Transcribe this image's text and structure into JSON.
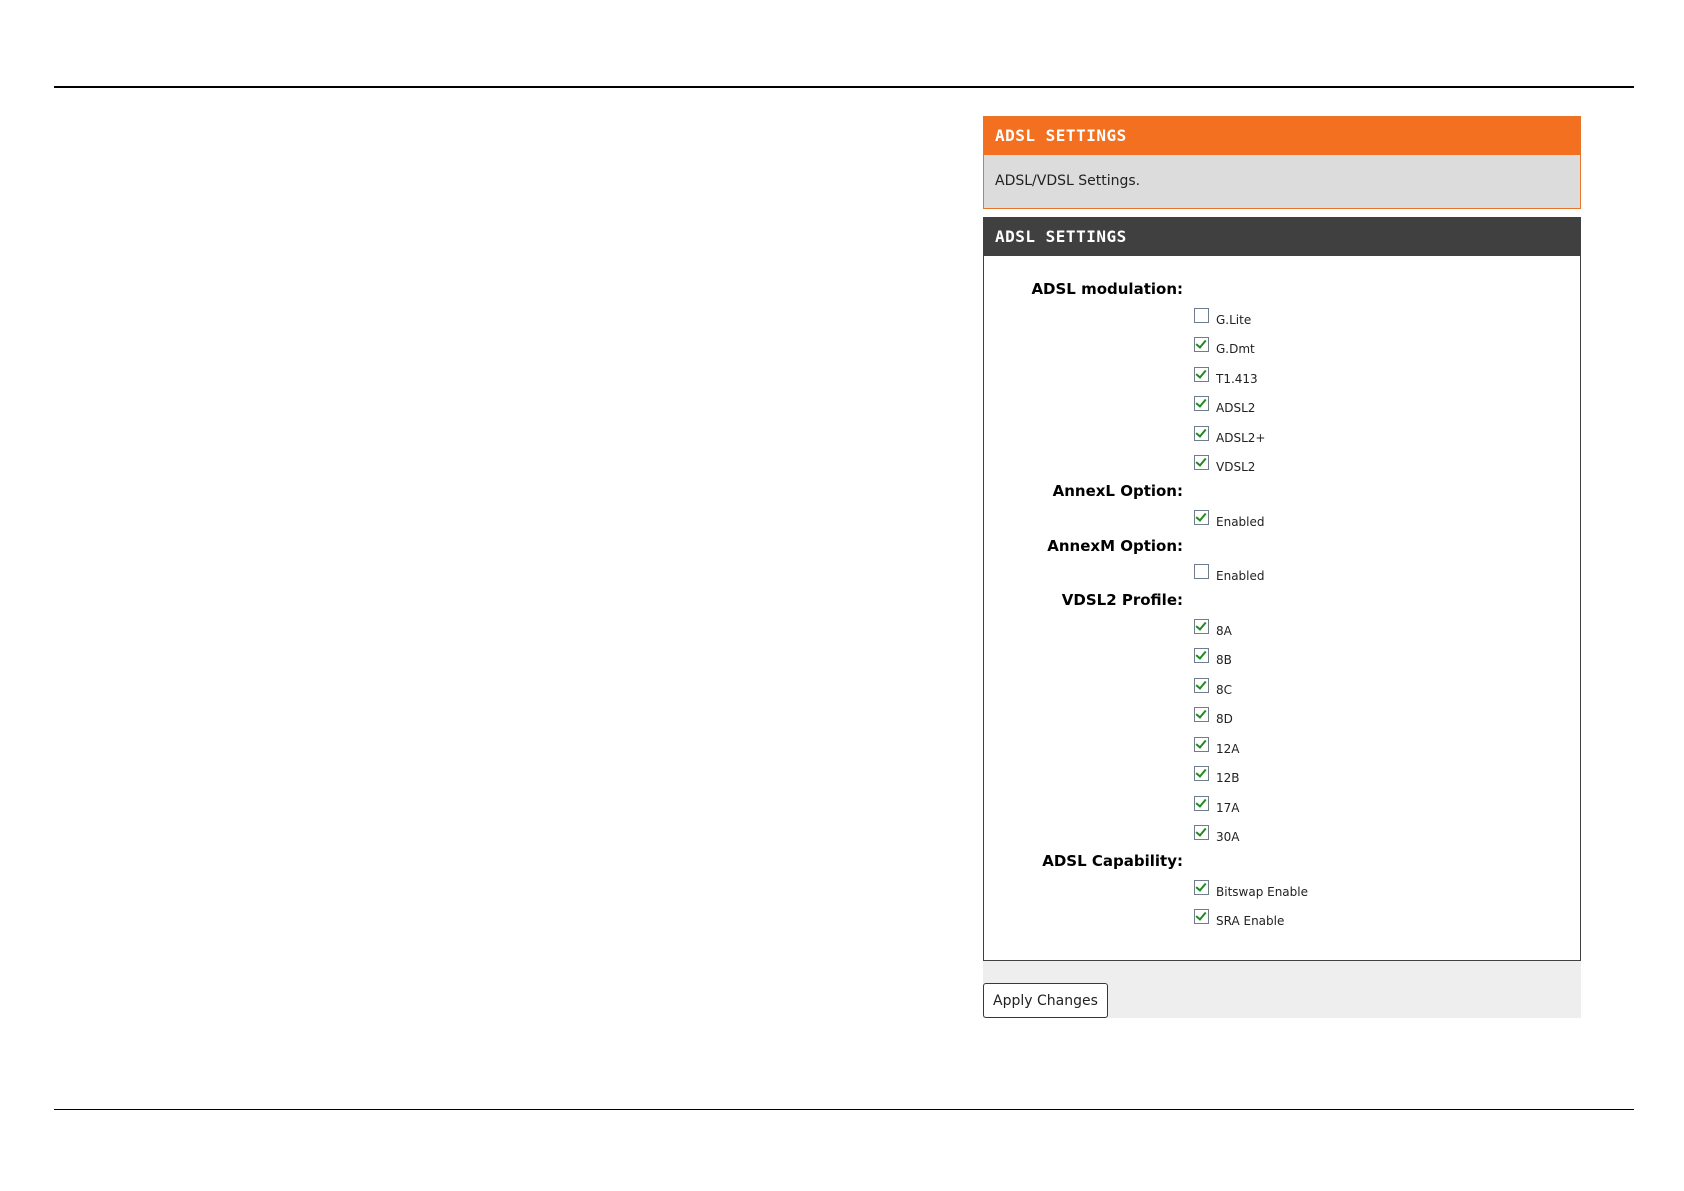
{
  "info": {
    "title": "ADSL SETTINGS",
    "description": "ADSL/VDSL Settings."
  },
  "settings": {
    "title": "ADSL SETTINGS",
    "groups": [
      {
        "label": "ADSL modulation:",
        "options": [
          {
            "label": "G.Lite",
            "checked": false
          },
          {
            "label": "G.Dmt",
            "checked": true
          },
          {
            "label": "T1.413",
            "checked": true
          },
          {
            "label": "ADSL2",
            "checked": true
          },
          {
            "label": "ADSL2+",
            "checked": true
          },
          {
            "label": "VDSL2",
            "checked": true
          }
        ]
      },
      {
        "label": "AnnexL Option:",
        "options": [
          {
            "label": "Enabled",
            "checked": true
          }
        ]
      },
      {
        "label": "AnnexM Option:",
        "options": [
          {
            "label": "Enabled",
            "checked": false
          }
        ]
      },
      {
        "label": "VDSL2 Profile:",
        "options": [
          {
            "label": "8A",
            "checked": true
          },
          {
            "label": "8B",
            "checked": true
          },
          {
            "label": "8C",
            "checked": true
          },
          {
            "label": "8D",
            "checked": true
          },
          {
            "label": "12A",
            "checked": true
          },
          {
            "label": "12B",
            "checked": true
          },
          {
            "label": "17A",
            "checked": true
          },
          {
            "label": "30A",
            "checked": true
          }
        ]
      },
      {
        "label": "ADSL Capability:",
        "options": [
          {
            "label": "Bitswap Enable",
            "checked": true
          },
          {
            "label": "SRA Enable",
            "checked": true
          }
        ]
      }
    ]
  },
  "apply_button": "Apply Changes",
  "colors": {
    "accent_orange": "#f37021",
    "header_dark": "#404040",
    "check_green": "#1e8a1e"
  }
}
